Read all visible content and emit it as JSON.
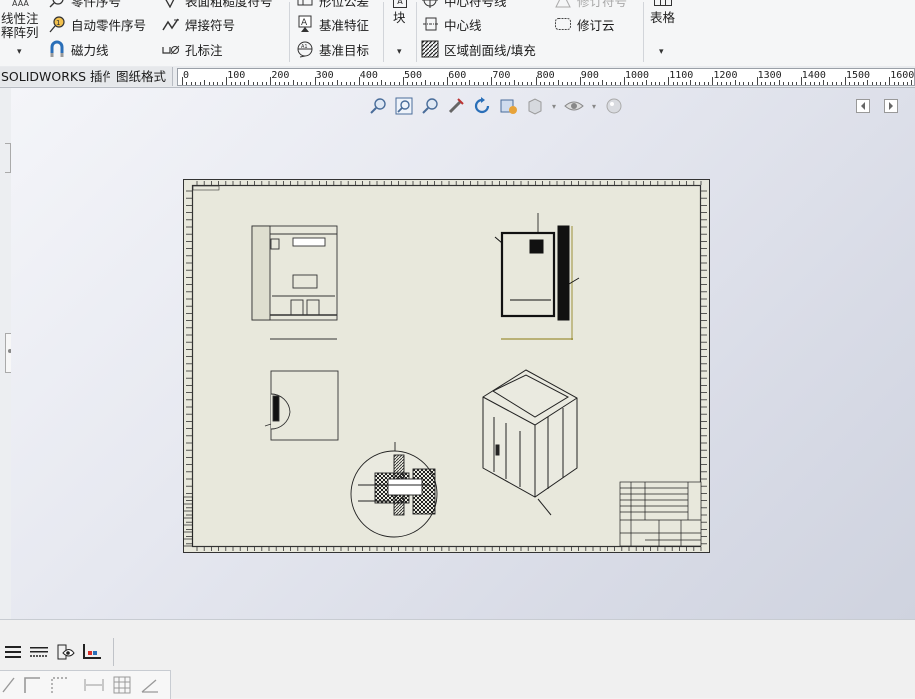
{
  "ribbon": {
    "left_group": {
      "line1": "线性注",
      "line2": "释阵列",
      "top_glyph": "AAA"
    },
    "items": {
      "balloon_partial": "零件序号",
      "auto_balloon": "自动零件序号",
      "magnetic_line": "磁力线",
      "surface_finish_partial": "表面粗糙度符号",
      "weld_symbol": "焊接符号",
      "hole_callout": "孔标注",
      "geometric_tolerance_partial": "形位公差",
      "datum_feature": "基准特征",
      "datum_target": "基准目标",
      "block": "块",
      "centermark_partial": "中心符号线",
      "centerline": "中心线",
      "area_hatch": "区域剖面线/填充",
      "revision_symbol_partial": "修订符号",
      "revision_cloud": "修订云",
      "table": "表格"
    }
  },
  "tabs": [
    {
      "label": "SOLIDWORKS 插件"
    },
    {
      "label": "图纸格式"
    }
  ],
  "ruler_labels": [
    "0",
    "100",
    "200",
    "300",
    "400",
    "500",
    "600",
    "700",
    "800",
    "900",
    "1000",
    "1100",
    "1200",
    "1300",
    "1400",
    "1500",
    "1600"
  ],
  "colors": {
    "sheet": "#e8e8dc",
    "canvas": "#dfe2ea",
    "ribbon": "#f5f6f7",
    "accent_blue": "#2a6fb8"
  }
}
